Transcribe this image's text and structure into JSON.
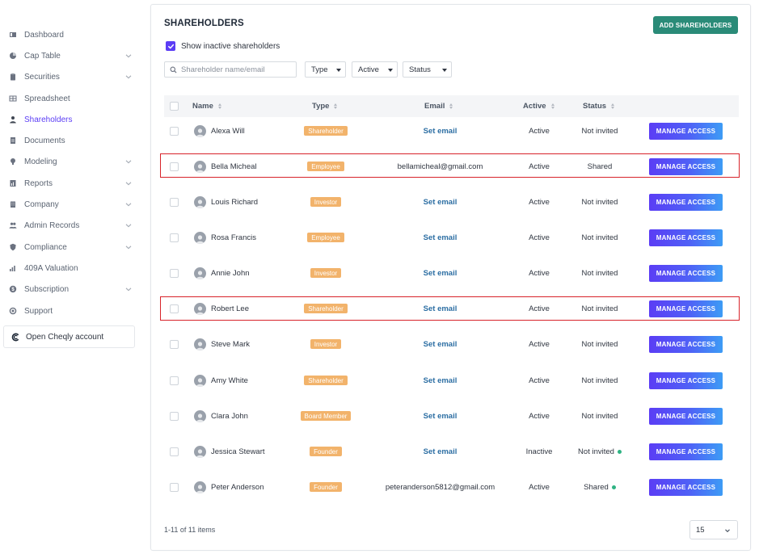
{
  "sidebar": {
    "items": [
      {
        "label": "Dashboard",
        "icon": "dashboard-icon",
        "chevron": false,
        "active": false
      },
      {
        "label": "Cap Table",
        "icon": "pie-chart-icon",
        "chevron": true,
        "active": false
      },
      {
        "label": "Securities",
        "icon": "clipboard-icon",
        "chevron": true,
        "active": false
      },
      {
        "label": "Spreadsheet",
        "icon": "table-icon",
        "chevron": false,
        "active": false
      },
      {
        "label": "Shareholders",
        "icon": "user-icon",
        "chevron": false,
        "active": true
      },
      {
        "label": "Documents",
        "icon": "document-icon",
        "chevron": false,
        "active": false
      },
      {
        "label": "Modeling",
        "icon": "bulb-icon",
        "chevron": true,
        "active": false
      },
      {
        "label": "Reports",
        "icon": "report-icon",
        "chevron": true,
        "active": false
      },
      {
        "label": "Company",
        "icon": "building-icon",
        "chevron": true,
        "active": false
      },
      {
        "label": "Admin Records",
        "icon": "users-icon",
        "chevron": true,
        "active": false
      },
      {
        "label": "Compliance",
        "icon": "shield-icon",
        "chevron": true,
        "active": false
      },
      {
        "label": "409A Valuation",
        "icon": "chart-icon",
        "chevron": false,
        "active": false
      },
      {
        "label": "Subscription",
        "icon": "dollar-icon",
        "chevron": true,
        "active": false
      },
      {
        "label": "Support",
        "icon": "support-icon",
        "chevron": false,
        "active": false
      }
    ],
    "cheqly_label": "Open Cheqly account"
  },
  "header": {
    "title": "SHAREHOLDERS",
    "add_button": "ADD SHAREHOLDERS",
    "show_inactive_label": "Show inactive shareholders"
  },
  "filters": {
    "search_placeholder": "Shareholder name/email",
    "type": "Type",
    "active": "Active",
    "status": "Status"
  },
  "table": {
    "headers": {
      "name": "Name",
      "type": "Type",
      "email": "Email",
      "active": "Active",
      "status": "Status"
    },
    "action_label": "MANAGE ACCESS",
    "rows": [
      {
        "name": "Alexa Will",
        "type": "Shareholder",
        "email": "Set email",
        "email_set": false,
        "active": "Active",
        "status": "Not invited",
        "dot": false
      },
      {
        "name": "Bella Micheal",
        "type": "Employee",
        "email": "bellamicheal@gmail.com",
        "email_set": true,
        "active": "Active",
        "status": "Shared",
        "dot": false
      },
      {
        "name": "Louis Richard",
        "type": "Investor",
        "email": "Set email",
        "email_set": false,
        "active": "Active",
        "status": "Not invited",
        "dot": false
      },
      {
        "name": "Rosa Francis",
        "type": "Employee",
        "email": "Set email",
        "email_set": false,
        "active": "Active",
        "status": "Not invited",
        "dot": false
      },
      {
        "name": "Annie John",
        "type": "Investor",
        "email": "Set email",
        "email_set": false,
        "active": "Active",
        "status": "Not invited",
        "dot": false
      },
      {
        "name": "Robert Lee",
        "type": "Shareholder",
        "email": "Set email",
        "email_set": false,
        "active": "Active",
        "status": "Not invited",
        "dot": false
      },
      {
        "name": "Steve Mark",
        "type": "Investor",
        "email": "Set email",
        "email_set": false,
        "active": "Active",
        "status": "Not invited",
        "dot": false
      },
      {
        "name": "Amy White",
        "type": "Shareholder",
        "email": "Set email",
        "email_set": false,
        "active": "Active",
        "status": "Not invited",
        "dot": false
      },
      {
        "name": "Clara John",
        "type": "Board Member",
        "email": "Set email",
        "email_set": false,
        "active": "Active",
        "status": "Not invited",
        "dot": false
      },
      {
        "name": "Jessica Stewart",
        "type": "Founder",
        "email": "Set email",
        "email_set": false,
        "active": "Inactive",
        "status": "Not invited",
        "dot": true
      },
      {
        "name": "Peter Anderson",
        "type": "Founder",
        "email": "peteranderson5812@gmail.com",
        "email_set": true,
        "active": "Active",
        "status": "Shared",
        "dot": true
      }
    ]
  },
  "footer": {
    "count_label": "1-11 of 11 items",
    "page_size": "15"
  },
  "colors": {
    "accent": "#5b3df5",
    "add_button": "#2a8b78",
    "badge": "#f2b36b",
    "link": "#2c6ea3",
    "status_dot": "#2fb383",
    "highlight": "#d8232a"
  }
}
